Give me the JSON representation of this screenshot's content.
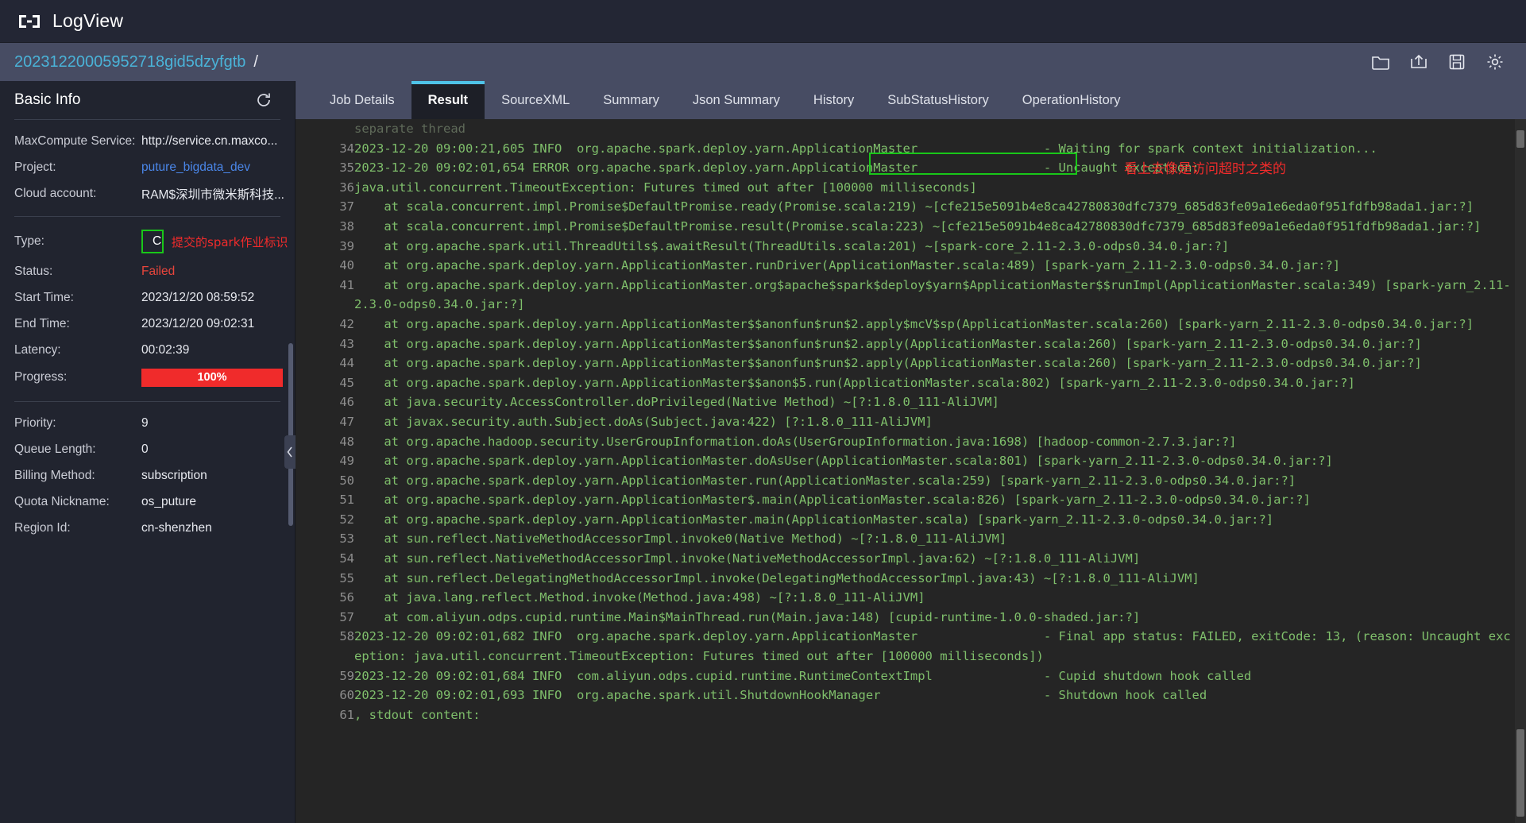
{
  "window": {
    "app_title": "LogView",
    "logo_icon": "logview-bracket-icon"
  },
  "breadcrumb": {
    "instance_id": "20231220005952718gid5dzyfgtb",
    "separator": "/",
    "tools": [
      {
        "name": "folder-open-icon",
        "title": "Open"
      },
      {
        "name": "share-out-icon",
        "title": "Export"
      },
      {
        "name": "save-disk-icon",
        "title": "Save"
      },
      {
        "name": "gear-icon",
        "title": "Settings"
      }
    ]
  },
  "sidebar": {
    "title": "Basic Info",
    "refresh_icon": "refresh-icon",
    "collapse_icon": "chevron-left-icon",
    "group1": [
      {
        "label": "MaxCompute Service:",
        "value": "http://service.cn.maxco...",
        "style": "plain"
      },
      {
        "label": "Project:",
        "value": "puture_bigdata_dev",
        "style": "link"
      },
      {
        "label": "Cloud account:",
        "value": "RAM$深圳市微米斯科技...",
        "style": "plain"
      }
    ],
    "group2": [
      {
        "label": "Type:",
        "value": "CUPID",
        "style": "boxed"
      },
      {
        "label": "Status:",
        "value": "Failed",
        "style": "failed"
      },
      {
        "label": "Start Time:",
        "value": "2023/12/20 08:59:52",
        "style": "plain"
      },
      {
        "label": "End Time:",
        "value": "2023/12/20 09:02:31",
        "style": "plain"
      },
      {
        "label": "Latency:",
        "value": "00:02:39",
        "style": "plain"
      },
      {
        "label": "Progress:",
        "value": "100%",
        "style": "progress"
      }
    ],
    "group3": [
      {
        "label": "Priority:",
        "value": "9",
        "style": "plain"
      },
      {
        "label": "Queue Length:",
        "value": "0",
        "style": "plain"
      },
      {
        "label": "Billing Method:",
        "value": "subscription",
        "style": "plain"
      },
      {
        "label": "Quota Nickname:",
        "value": "os_puture",
        "style": "plain"
      },
      {
        "label": "Region Id:",
        "value": "cn-shenzhen",
        "style": "plain"
      }
    ]
  },
  "annotations": {
    "type_note": "提交的spark作业标识",
    "timeout_note": "看上去像是访问超时之类的"
  },
  "tabs": [
    {
      "label": "Job Details",
      "active": false
    },
    {
      "label": "Result",
      "active": true
    },
    {
      "label": "SourceXML",
      "active": false
    },
    {
      "label": "Summary",
      "active": false
    },
    {
      "label": "Json Summary",
      "active": false
    },
    {
      "label": "History",
      "active": false
    },
    {
      "label": "SubStatusHistory",
      "active": false
    },
    {
      "label": "OperationHistory",
      "active": false
    }
  ],
  "log": {
    "lines": [
      {
        "n": "",
        "text": "separate thread",
        "dim": true
      },
      {
        "n": "34",
        "text": "2023-12-20 09:00:21,605 INFO  org.apache.spark.deploy.yarn.ApplicationMaster                 - Waiting for spark context initialization..."
      },
      {
        "n": "35",
        "text": "2023-12-20 09:02:01,654 ERROR org.apache.spark.deploy.yarn.ApplicationMaster                 - Uncaught exception:"
      },
      {
        "n": "36",
        "text": "java.util.concurrent.TimeoutException: Futures timed out after [100000 milliseconds]"
      },
      {
        "n": "37",
        "text": "    at scala.concurrent.impl.Promise$DefaultPromise.ready(Promise.scala:219) ~[cfe215e5091b4e8ca42780830dfc7379_685d83fe09a1e6eda0f951fdfb98ada1.jar:?]"
      },
      {
        "n": "38",
        "text": "    at scala.concurrent.impl.Promise$DefaultPromise.result(Promise.scala:223) ~[cfe215e5091b4e8ca42780830dfc7379_685d83fe09a1e6eda0f951fdfb98ada1.jar:?]"
      },
      {
        "n": "39",
        "text": "    at org.apache.spark.util.ThreadUtils$.awaitResult(ThreadUtils.scala:201) ~[spark-core_2.11-2.3.0-odps0.34.0.jar:?]"
      },
      {
        "n": "40",
        "text": "    at org.apache.spark.deploy.yarn.ApplicationMaster.runDriver(ApplicationMaster.scala:489) [spark-yarn_2.11-2.3.0-odps0.34.0.jar:?]"
      },
      {
        "n": "41",
        "text": "    at org.apache.spark.deploy.yarn.ApplicationMaster.org$apache$spark$deploy$yarn$ApplicationMaster$$runImpl(ApplicationMaster.scala:349) [spark-yarn_2.11-2.3.0-odps0.34.0.jar:?]"
      },
      {
        "n": "42",
        "text": "    at org.apache.spark.deploy.yarn.ApplicationMaster$$anonfun$run$2.apply$mcV$sp(ApplicationMaster.scala:260) [spark-yarn_2.11-2.3.0-odps0.34.0.jar:?]"
      },
      {
        "n": "43",
        "text": "    at org.apache.spark.deploy.yarn.ApplicationMaster$$anonfun$run$2.apply(ApplicationMaster.scala:260) [spark-yarn_2.11-2.3.0-odps0.34.0.jar:?]"
      },
      {
        "n": "44",
        "text": "    at org.apache.spark.deploy.yarn.ApplicationMaster$$anonfun$run$2.apply(ApplicationMaster.scala:260) [spark-yarn_2.11-2.3.0-odps0.34.0.jar:?]"
      },
      {
        "n": "45",
        "text": "    at org.apache.spark.deploy.yarn.ApplicationMaster$$anon$5.run(ApplicationMaster.scala:802) [spark-yarn_2.11-2.3.0-odps0.34.0.jar:?]"
      },
      {
        "n": "46",
        "text": "    at java.security.AccessController.doPrivileged(Native Method) ~[?:1.8.0_111-AliJVM]"
      },
      {
        "n": "47",
        "text": "    at javax.security.auth.Subject.doAs(Subject.java:422) [?:1.8.0_111-AliJVM]"
      },
      {
        "n": "48",
        "text": "    at org.apache.hadoop.security.UserGroupInformation.doAs(UserGroupInformation.java:1698) [hadoop-common-2.7.3.jar:?]"
      },
      {
        "n": "49",
        "text": "    at org.apache.spark.deploy.yarn.ApplicationMaster.doAsUser(ApplicationMaster.scala:801) [spark-yarn_2.11-2.3.0-odps0.34.0.jar:?]"
      },
      {
        "n": "50",
        "text": "    at org.apache.spark.deploy.yarn.ApplicationMaster.run(ApplicationMaster.scala:259) [spark-yarn_2.11-2.3.0-odps0.34.0.jar:?]"
      },
      {
        "n": "51",
        "text": "    at org.apache.spark.deploy.yarn.ApplicationMaster$.main(ApplicationMaster.scala:826) [spark-yarn_2.11-2.3.0-odps0.34.0.jar:?]"
      },
      {
        "n": "52",
        "text": "    at org.apache.spark.deploy.yarn.ApplicationMaster.main(ApplicationMaster.scala) [spark-yarn_2.11-2.3.0-odps0.34.0.jar:?]"
      },
      {
        "n": "53",
        "text": "    at sun.reflect.NativeMethodAccessorImpl.invoke0(Native Method) ~[?:1.8.0_111-AliJVM]"
      },
      {
        "n": "54",
        "text": "    at sun.reflect.NativeMethodAccessorImpl.invoke(NativeMethodAccessorImpl.java:62) ~[?:1.8.0_111-AliJVM]"
      },
      {
        "n": "55",
        "text": "    at sun.reflect.DelegatingMethodAccessorImpl.invoke(DelegatingMethodAccessorImpl.java:43) ~[?:1.8.0_111-AliJVM]"
      },
      {
        "n": "56",
        "text": "    at java.lang.reflect.Method.invoke(Method.java:498) ~[?:1.8.0_111-AliJVM]"
      },
      {
        "n": "57",
        "text": "    at com.aliyun.odps.cupid.runtime.Main$MainThread.run(Main.java:148) [cupid-runtime-1.0.0-shaded.jar:?]"
      },
      {
        "n": "58",
        "text": "2023-12-20 09:02:01,682 INFO  org.apache.spark.deploy.yarn.ApplicationMaster                 - Final app status: FAILED, exitCode: 13, (reason: Uncaught exception: java.util.concurrent.TimeoutException: Futures timed out after [100000 milliseconds])"
      },
      {
        "n": "59",
        "text": "2023-12-20 09:02:01,684 INFO  com.aliyun.odps.cupid.runtime.RuntimeContextImpl               - Cupid shutdown hook called"
      },
      {
        "n": "60",
        "text": "2023-12-20 09:02:01,693 INFO  org.apache.spark.util.ShutdownHookManager                      - Shutdown hook called"
      },
      {
        "n": "61",
        "text": ", stdout content:"
      }
    ]
  },
  "colors": {
    "accent": "#4fc3e8",
    "link": "#4a86e8",
    "error": "#e8453c",
    "progress": "#f02b2b",
    "highlight": "#19c719",
    "log_text": "#7fbf6b",
    "annotation": "#f12b2b"
  }
}
